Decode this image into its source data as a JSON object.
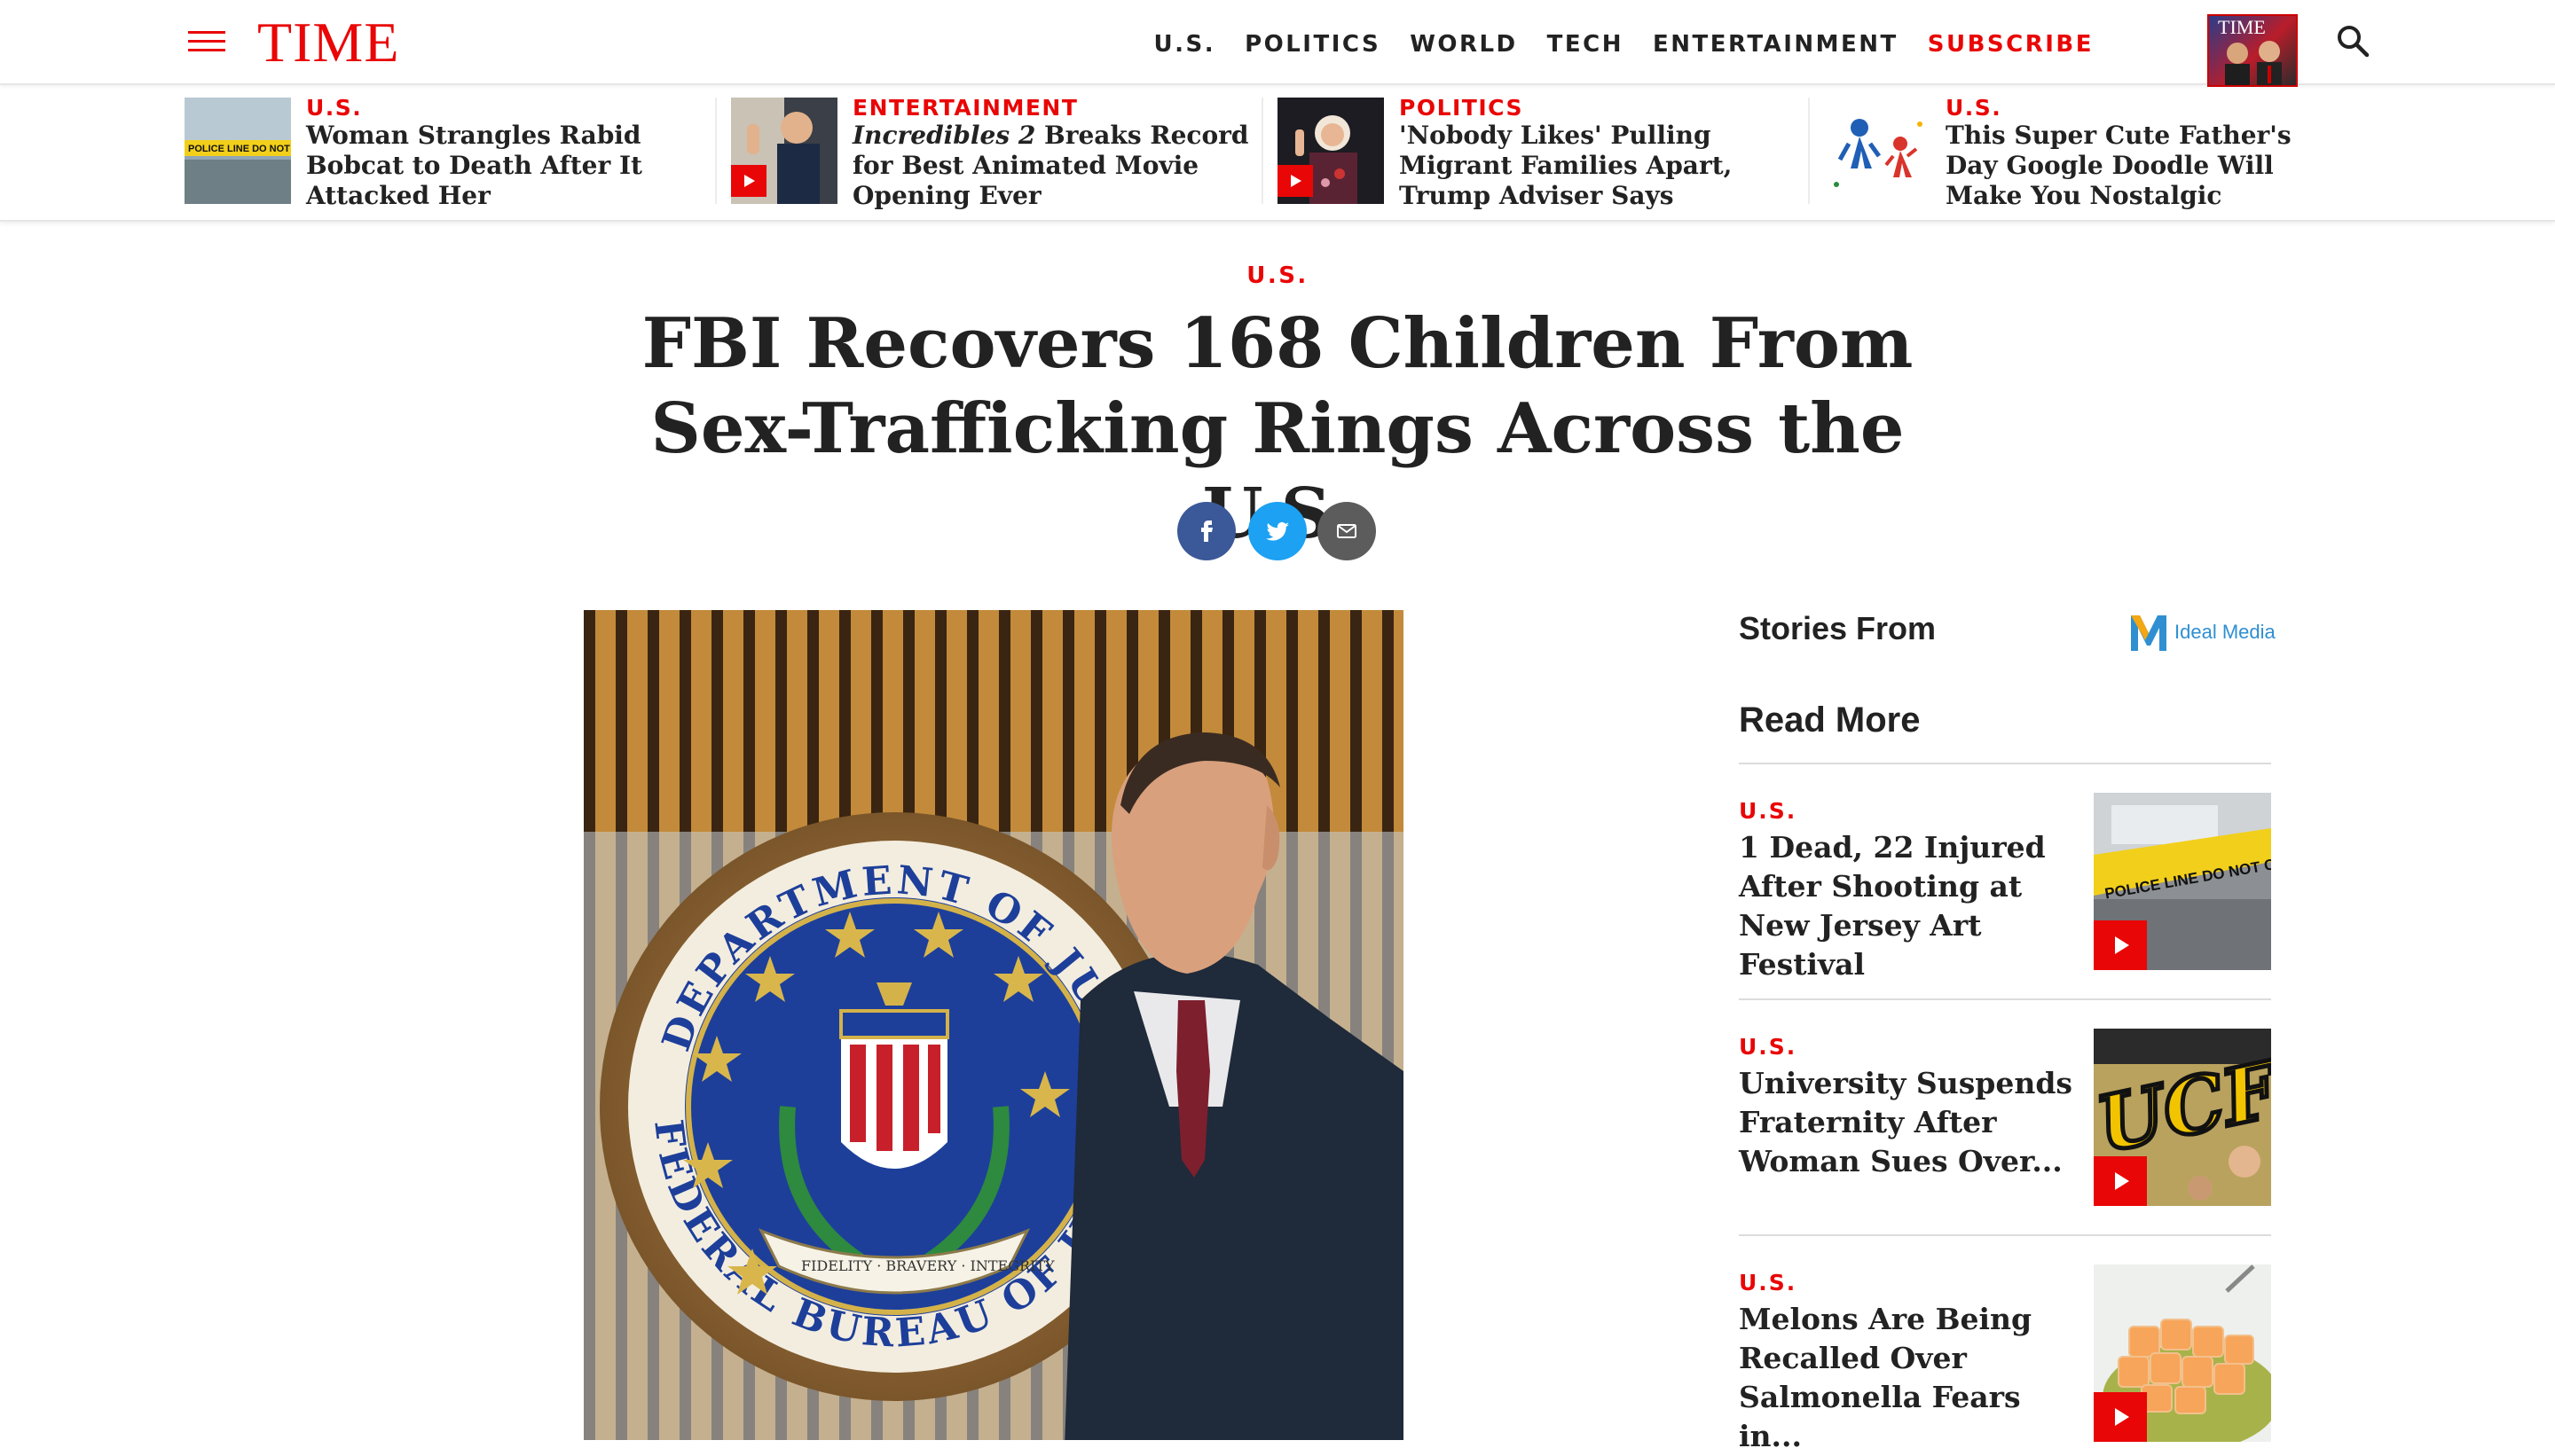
{
  "brand": {
    "logo": "TIME",
    "accent_color": "#e90606"
  },
  "nav": {
    "items": [
      "U.S.",
      "POLITICS",
      "WORLD",
      "TECH",
      "ENTERTAINMENT"
    ],
    "subscribe": "SUBSCRIBE",
    "cover_logo": "TIME"
  },
  "trending": [
    {
      "category": "U.S.",
      "title": "Woman Strangles Rabid Bobcat to Death After It Attacked Her",
      "tape_text": "POLICE LINE DO NOT CR",
      "has_video": false
    },
    {
      "category": "ENTERTAINMENT",
      "title_italic": "Incredibles 2",
      "title_rest": " Breaks Record for Best Animated Movie Opening Ever",
      "has_video": true
    },
    {
      "category": "POLITICS",
      "title": "'Nobody Likes' Pulling Migrant Families Apart, Trump Adviser Says",
      "has_video": true
    },
    {
      "category": "U.S.",
      "title": "This Super Cute Father's Day Google Doodle Will Make You Nostalgic",
      "has_video": false
    }
  ],
  "article": {
    "section": "U.S.",
    "headline": "FBI Recovers 168 Children From Sex-Trafficking Rings Across the U.S.",
    "share": [
      "facebook",
      "twitter",
      "email"
    ],
    "seal_top_text": "DEPARTMENT OF JUSTICE",
    "seal_bottom_text": "FEDERAL BUREAU OF INVES",
    "seal_ribbon_text": "FIDELITY · BRAVERY · INTEGRITY"
  },
  "sidebar": {
    "stories_from": "Stories From",
    "ideal_media": "Ideal Media",
    "read_more": "Read More",
    "items": [
      {
        "category": "U.S.",
        "title": "1 Dead, 22 Injured After Shooting at New Jersey Art Festival",
        "tape_text": "POLICE LINE DO NOT CROSS",
        "has_video": true
      },
      {
        "category": "U.S.",
        "title": "University Suspends Fraternity After Woman Sues Over...",
        "thumb_text": "UCF",
        "has_video": true
      },
      {
        "category": "U.S.",
        "title": "Melons Are Being Recalled Over Salmonella Fears in...",
        "has_video": true
      }
    ]
  }
}
